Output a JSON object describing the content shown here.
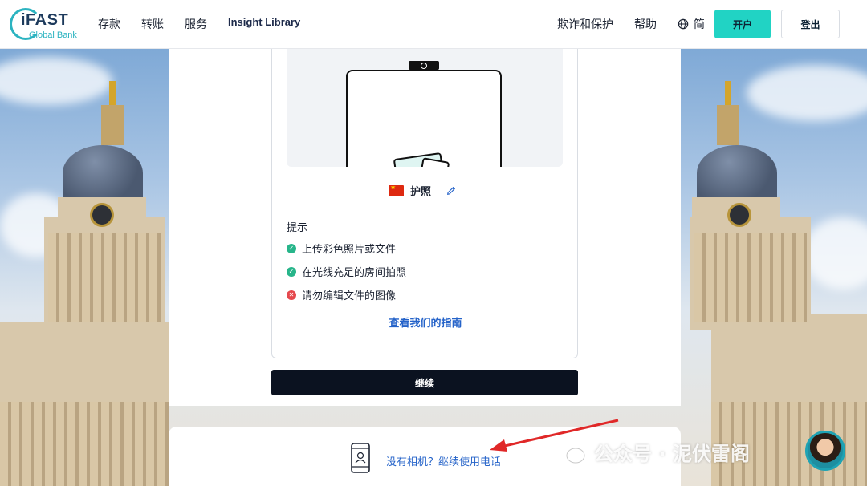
{
  "header": {
    "logo": {
      "brand": "iFAST",
      "sub": "Global Bank"
    },
    "nav_left": [
      "存款",
      "转账",
      "服务",
      "Insight Library"
    ],
    "nav_right": {
      "fraud": "欺诈和保护",
      "help": "帮助",
      "lang": "简"
    },
    "open_account": "开户",
    "logout": "登出"
  },
  "verify": {
    "document": "护照",
    "tips_title": "提示",
    "tips": [
      {
        "text": "上传彩色照片或文件",
        "ok": true
      },
      {
        "text": "在光线充足的房间拍照",
        "ok": true
      },
      {
        "text": "请勿编辑文件的图像",
        "ok": false
      }
    ],
    "guide_link": "查看我们的指南",
    "continue": "继续"
  },
  "bottom": {
    "no_camera": "没有相机？继续使用电话"
  },
  "overlay": {
    "watermark": "公众号 · 泥伏雷阁"
  },
  "colors": {
    "accent": "#21d3c4",
    "link": "#2563c9",
    "primary_button": "#0b1220",
    "ok": "#27b58a",
    "error": "#e5484d"
  }
}
